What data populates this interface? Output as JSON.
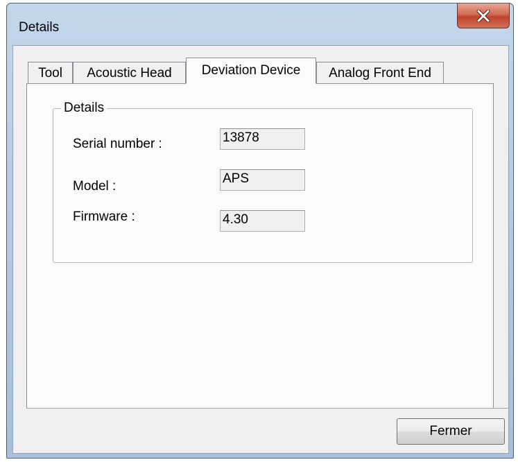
{
  "window": {
    "title": "Details"
  },
  "tabs": [
    {
      "label": "Tool",
      "active": false
    },
    {
      "label": "Acoustic Head",
      "active": false
    },
    {
      "label": "Deviation Device",
      "active": true
    },
    {
      "label": "Analog Front End",
      "active": false
    }
  ],
  "details_group": {
    "legend": "Details",
    "fields": [
      {
        "label": "Serial number :",
        "value": "13878"
      },
      {
        "label": "Model :",
        "value": "APS"
      },
      {
        "label": "Firmware :",
        "value": "4.30"
      }
    ]
  },
  "footer": {
    "close_label": "Fermer"
  },
  "colors": {
    "close_button_red": "#c3412a",
    "frame_blue": "#b2c8e0",
    "dialog_gray": "#f0f0f0"
  },
  "icons": {
    "close": "close-x-icon"
  }
}
